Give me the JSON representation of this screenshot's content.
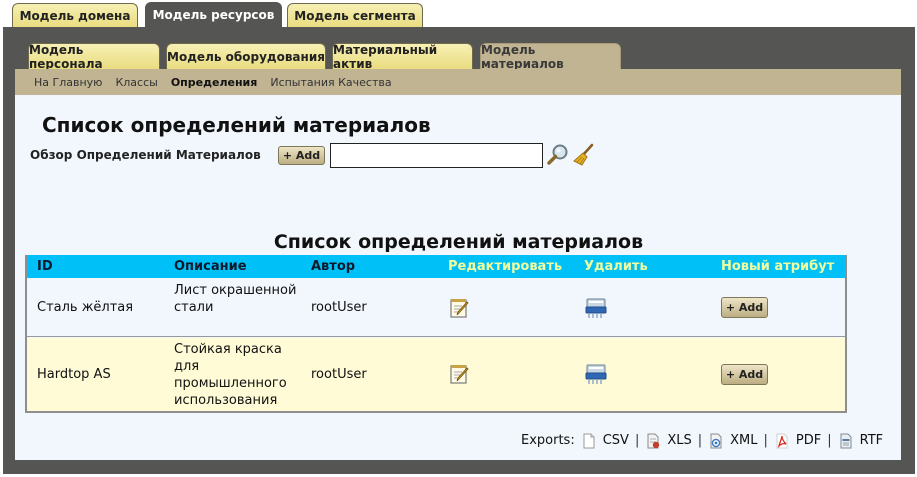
{
  "top_tabs": [
    {
      "label": "Модель домена",
      "active": false
    },
    {
      "label": "Модель ресурсов",
      "active": true
    },
    {
      "label": "Модель сегмента",
      "active": false
    }
  ],
  "sub_tabs": [
    {
      "label": "Модель персонала",
      "active": false
    },
    {
      "label": "Модель оборудования",
      "active": false
    },
    {
      "label": "Материальный актив",
      "active": false
    },
    {
      "label": "Модель материалов",
      "active": true
    }
  ],
  "breadcrumb": [
    {
      "label": "На Главную",
      "active": false
    },
    {
      "label": "Классы",
      "active": false
    },
    {
      "label": "Определения",
      "active": true
    },
    {
      "label": "Испытания Качества",
      "active": false
    }
  ],
  "page": {
    "title": "Список определений материалов",
    "browse_label": "Обзор Определений Материалов",
    "add_label": "+ Add",
    "search": {
      "value": "",
      "placeholder": ""
    }
  },
  "table": {
    "title": "Список определений материалов",
    "headers": {
      "id": "ID",
      "description": "Описание",
      "author": "Автор",
      "edit": "Редактировать",
      "delete": "Удалить",
      "new_attribute": "Новый атрибут"
    },
    "rows": [
      {
        "id": "Сталь жёлтая",
        "description": "Лист окрашенной стали",
        "author": "rootUser",
        "add_label": "+ Add"
      },
      {
        "id": "Hardtop AS",
        "description": "Стойкая краска для промышленного использования",
        "author": "rootUser",
        "add_label": "+ Add"
      }
    ]
  },
  "exports": {
    "label": "Exports:",
    "formats": [
      "CSV",
      "XLS",
      "XML",
      "PDF",
      "RTF"
    ],
    "separator": "|"
  },
  "colors": {
    "frame": "#555553",
    "tab_gold": "#e9dc80",
    "breadcrumb_bar": "#c1b493",
    "content_bg": "#f1f7fd",
    "table_header": "#00c0f8",
    "header_light_text": "#f1ff9e",
    "row_alt": "#fffbd6"
  },
  "icons": {
    "search": "magnifier-icon",
    "clear": "broom-icon",
    "edit": "pencil-notepad-icon",
    "delete": "shredder-icon",
    "csv": "blank-file-icon",
    "xls": "spreadsheet-file-icon",
    "xml": "xml-file-icon",
    "pdf": "pdf-icon",
    "rtf": "document-icon"
  }
}
